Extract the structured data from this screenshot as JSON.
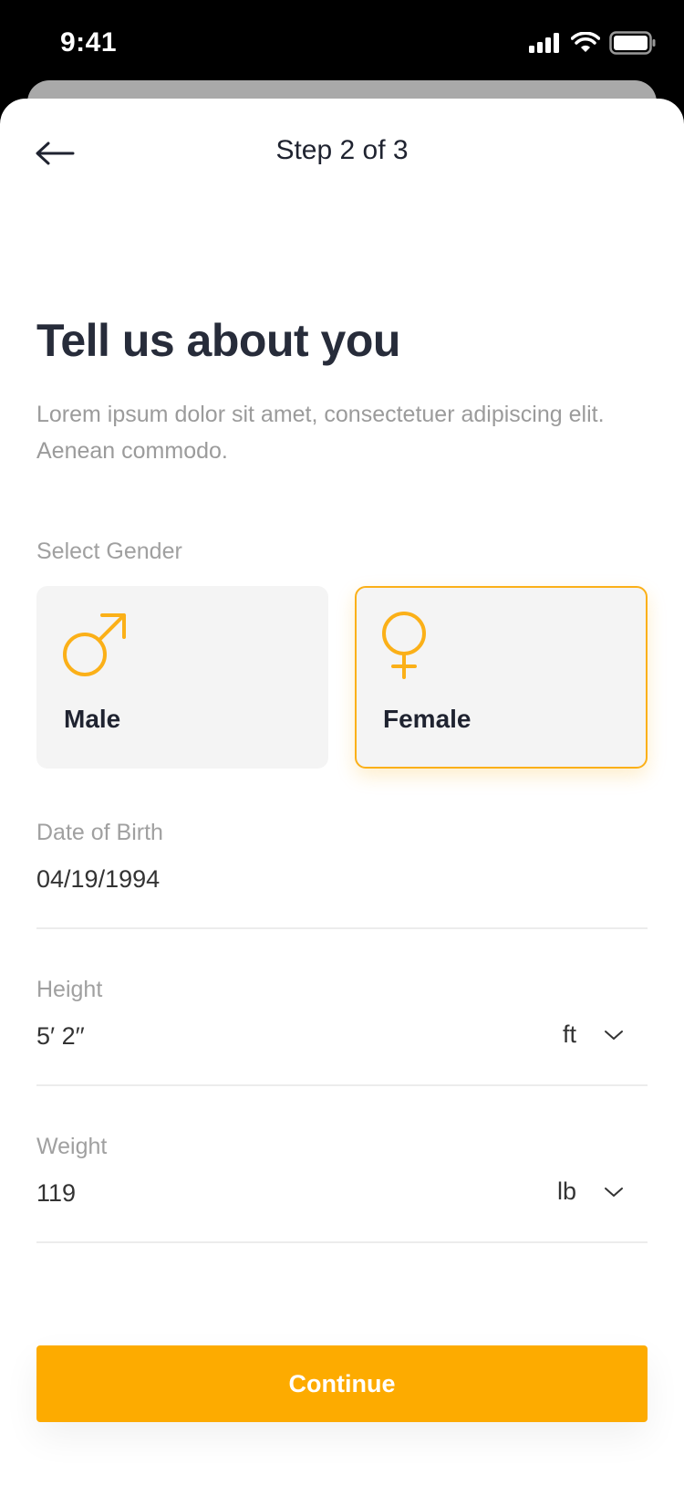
{
  "status_bar": {
    "time": "9:41",
    "icons": [
      "signal-icon",
      "wifi-icon",
      "battery-icon"
    ]
  },
  "nav": {
    "back_icon": "arrow-left-icon",
    "title": "Step 2 of 3"
  },
  "heading": "Tell us about you",
  "subtitle": "Lorem ipsum dolor sit amet, consectetuer adipiscing elit. Aenean commodo.",
  "gender": {
    "label": "Select Gender",
    "selected": "Female",
    "options": [
      {
        "label": "Male",
        "icon": "male-symbol-icon"
      },
      {
        "label": "Female",
        "icon": "female-symbol-icon"
      }
    ]
  },
  "date_of_birth": {
    "label": "Date of Birth",
    "value": "04/19/1994"
  },
  "height": {
    "label": "Height",
    "value": "5′ 2′′",
    "unit": "ft"
  },
  "weight": {
    "label": "Weight",
    "value": "119",
    "unit": "lb"
  },
  "continue_label": "Continue",
  "colors": {
    "accent": "#FDAB00",
    "heading": "#272C3A",
    "muted": "#9B9B9B",
    "card_bg": "#F4F4F4"
  }
}
